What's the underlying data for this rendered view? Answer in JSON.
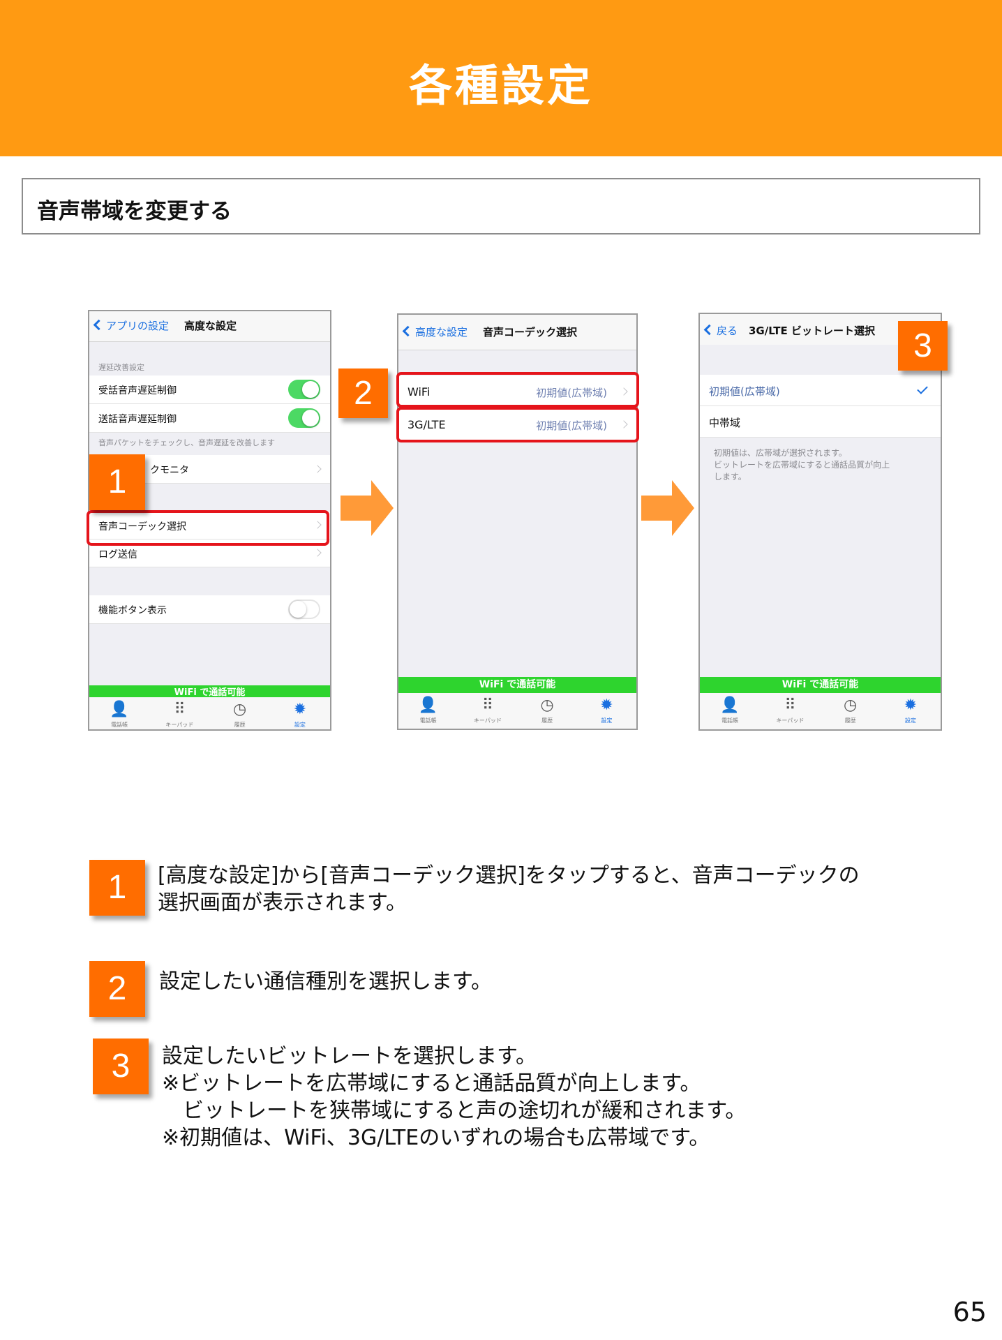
{
  "header": {
    "title": "各種設定"
  },
  "section": {
    "title": "音声帯域を変更する"
  },
  "screen1": {
    "back_label": "アプリの設定",
    "title": "高度な設定",
    "group_label": "遅延改善設定",
    "rows": {
      "receive_delay": "受話音声遅延制御",
      "send_delay": "送話音声遅延制御",
      "note": "音声パケットをチェックし、音声遅延を改善します",
      "network_monitor": "クモニタ",
      "codec_select": "音声コーデック選択",
      "log_send": "ログ送信",
      "function_button": "機能ボタン表示"
    },
    "toggles": {
      "receive_delay": true,
      "send_delay": true,
      "function_button": false
    }
  },
  "screen2": {
    "back_label": "高度な設定",
    "title": "音声コーデック選択",
    "rows": [
      {
        "label": "WiFi",
        "value": "初期値(広帯域)"
      },
      {
        "label": "3G/LTE",
        "value": "初期値(広帯域)"
      }
    ]
  },
  "screen3": {
    "back_label": "戻る",
    "title": "3G/LTE ビットレート選択",
    "rows": [
      {
        "label": "初期値(広帯域)",
        "selected": true
      },
      {
        "label": "中帯域",
        "selected": false
      }
    ],
    "note": [
      "初期値は、広帯域が選択されます。",
      "ビットレートを広帯域にすると通話品質が向上",
      "します。"
    ]
  },
  "status_bar_text": "WiFi で通話可能",
  "tabs": [
    {
      "label": "電話帳",
      "icon": "person-icon"
    },
    {
      "label": "キーパッド",
      "icon": "keypad-icon"
    },
    {
      "label": "履歴",
      "icon": "clock-icon"
    },
    {
      "label": "設定",
      "icon": "gear-icon",
      "active": true
    }
  ],
  "badges": [
    "1",
    "2",
    "3"
  ],
  "steps": [
    {
      "number": "1",
      "lines": [
        "[高度な設定]から[音声コーデック選択]をタップすると、音声コーデックの",
        "選択画面が表示されます。"
      ]
    },
    {
      "number": "2",
      "lines": [
        "設定したい通信種別を選択します。"
      ]
    },
    {
      "number": "3",
      "lines": [
        "設定したいビットレートを選択します。",
        "※ビットレートを広帯域にすると通話品質が向上します。",
        "ビットレートを狭帯域にすると声の途切れが緩和されます。",
        "※初期値は、WiFi、3G/LTEのいずれの場合も広帯域です。"
      ]
    }
  ],
  "colors": {
    "header": "#ff9a12",
    "badge": "#ff6d00",
    "highlight": "#e5141b",
    "status_green": "#2ed42e",
    "ios_blue": "#1a6fe0"
  },
  "page_number": "65"
}
